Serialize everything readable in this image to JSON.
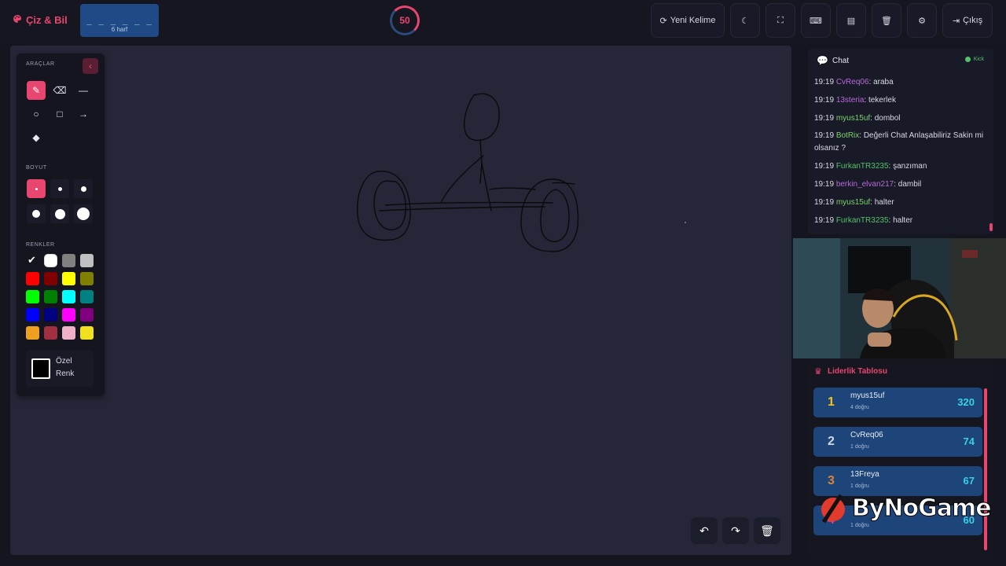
{
  "topbar": {
    "brand": "Çiz & Bil",
    "word_hint": "_ _ _ _ _ _",
    "word_length": "6 harf",
    "timer": "50",
    "buttons": {
      "new_word": "Yeni Kelime",
      "exit": "Çıkış"
    }
  },
  "tools_panel": {
    "tools_title": "ARAÇLAR",
    "size_title": "BOYUT",
    "colors_title": "RENKLER",
    "custom_line1": "Özel",
    "custom_line2": "Renk",
    "tools": [
      "brush-icon",
      "eraser-icon",
      "line-icon",
      "circle-icon",
      "square-icon",
      "arrow-icon",
      "fill-icon"
    ],
    "colors": [
      "#000000",
      "#ffffff",
      "#808080",
      "#c0c0c0",
      "#ff0000",
      "#800000",
      "#ffff00",
      "#808000",
      "#00ff00",
      "#008000",
      "#00ffff",
      "#008080",
      "#0000ff",
      "#000080",
      "#ff00ff",
      "#800080",
      "#f0a020",
      "#a03040",
      "#f0b0c8",
      "#f0e020"
    ]
  },
  "chat": {
    "title": "Chat",
    "status": "Kick",
    "messages": [
      {
        "time": "19:19",
        "user": "CvReq06",
        "text": ": araba",
        "color": "#b96ad9"
      },
      {
        "time": "19:19",
        "user": "13steria",
        "text": ": tekerlek",
        "color": "#b96ad9"
      },
      {
        "time": "19:19",
        "user": "myus15uf",
        "text": ": dombol",
        "color": "#7cd36b"
      },
      {
        "time": "19:19",
        "user": "BotRix",
        "text": ": Değerli Chat Anlaşabiliriz Sakin mi olsanız ?",
        "color": "#7cd36b"
      },
      {
        "time": "19:19",
        "user": "FurkanTR3235",
        "text": ": şanzıman",
        "color": "#53c26a"
      },
      {
        "time": "19:19",
        "user": "berkin_elvan217",
        "text": ": dambil",
        "color": "#b96ad9"
      },
      {
        "time": "19:19",
        "user": "myus15uf",
        "text": ": halter",
        "color": "#7cd36b"
      },
      {
        "time": "19:19",
        "user": "FurkanTR3235",
        "text": ": halter",
        "color": "#53c26a"
      }
    ]
  },
  "leaderboard": {
    "title": "Liderlik Tablosu",
    "rows": [
      {
        "rank": "1",
        "name": "myus15uf",
        "sub": "4 doğru",
        "score": "320",
        "rank_color": "#f2c21b"
      },
      {
        "rank": "2",
        "name": "CvReq06",
        "sub": "1 doğru",
        "score": "74",
        "rank_color": "#d0d6e6"
      },
      {
        "rank": "3",
        "name": "13Freya",
        "sub": "1 doğru",
        "score": "67",
        "rank_color": "#d9843a"
      },
      {
        "rank": "4",
        "name": "",
        "sub": "1 doğru",
        "score": "60",
        "rank_color": "#e8456f"
      }
    ]
  },
  "watermark": "ByNoGame"
}
